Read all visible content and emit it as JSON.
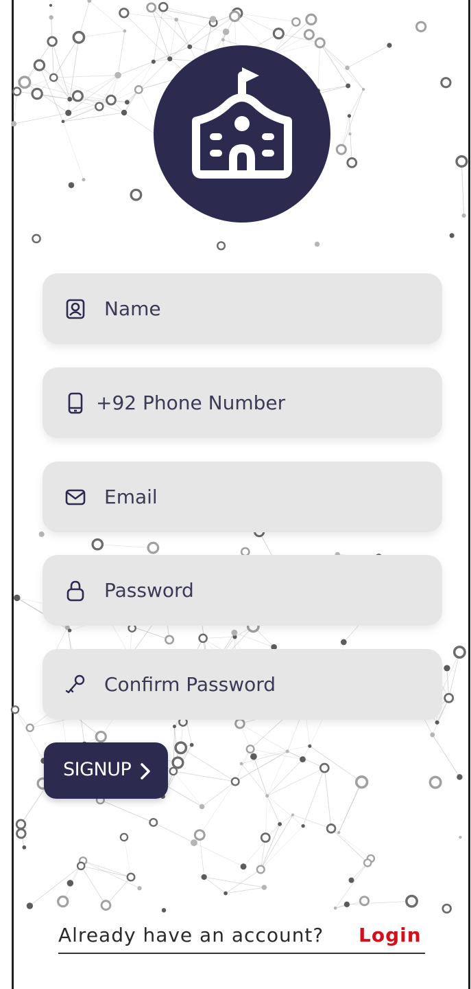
{
  "form": {
    "name_placeholder": "Name",
    "phone_prefix": "+92",
    "phone_placeholder": "Phone Number",
    "email_placeholder": "Email",
    "password_placeholder": "Password",
    "confirm_password_placeholder": "Confirm Password"
  },
  "signup_button": {
    "label": "SIGNUP"
  },
  "footer": {
    "question": "Already have an account?",
    "login_link": "Login"
  },
  "icons": {
    "logo": "school-building-icon",
    "name": "user-card-icon",
    "phone": "mobile-phone-icon",
    "email": "envelope-icon",
    "password": "lock-icon",
    "confirm_password": "key-icon",
    "signup_arrow": "chevron-right-icon"
  },
  "colors": {
    "brand_navy": "#2c2a4f",
    "field_bg": "#e6e6e6",
    "link_red": "#d4101c",
    "text": "#3a3a55"
  }
}
